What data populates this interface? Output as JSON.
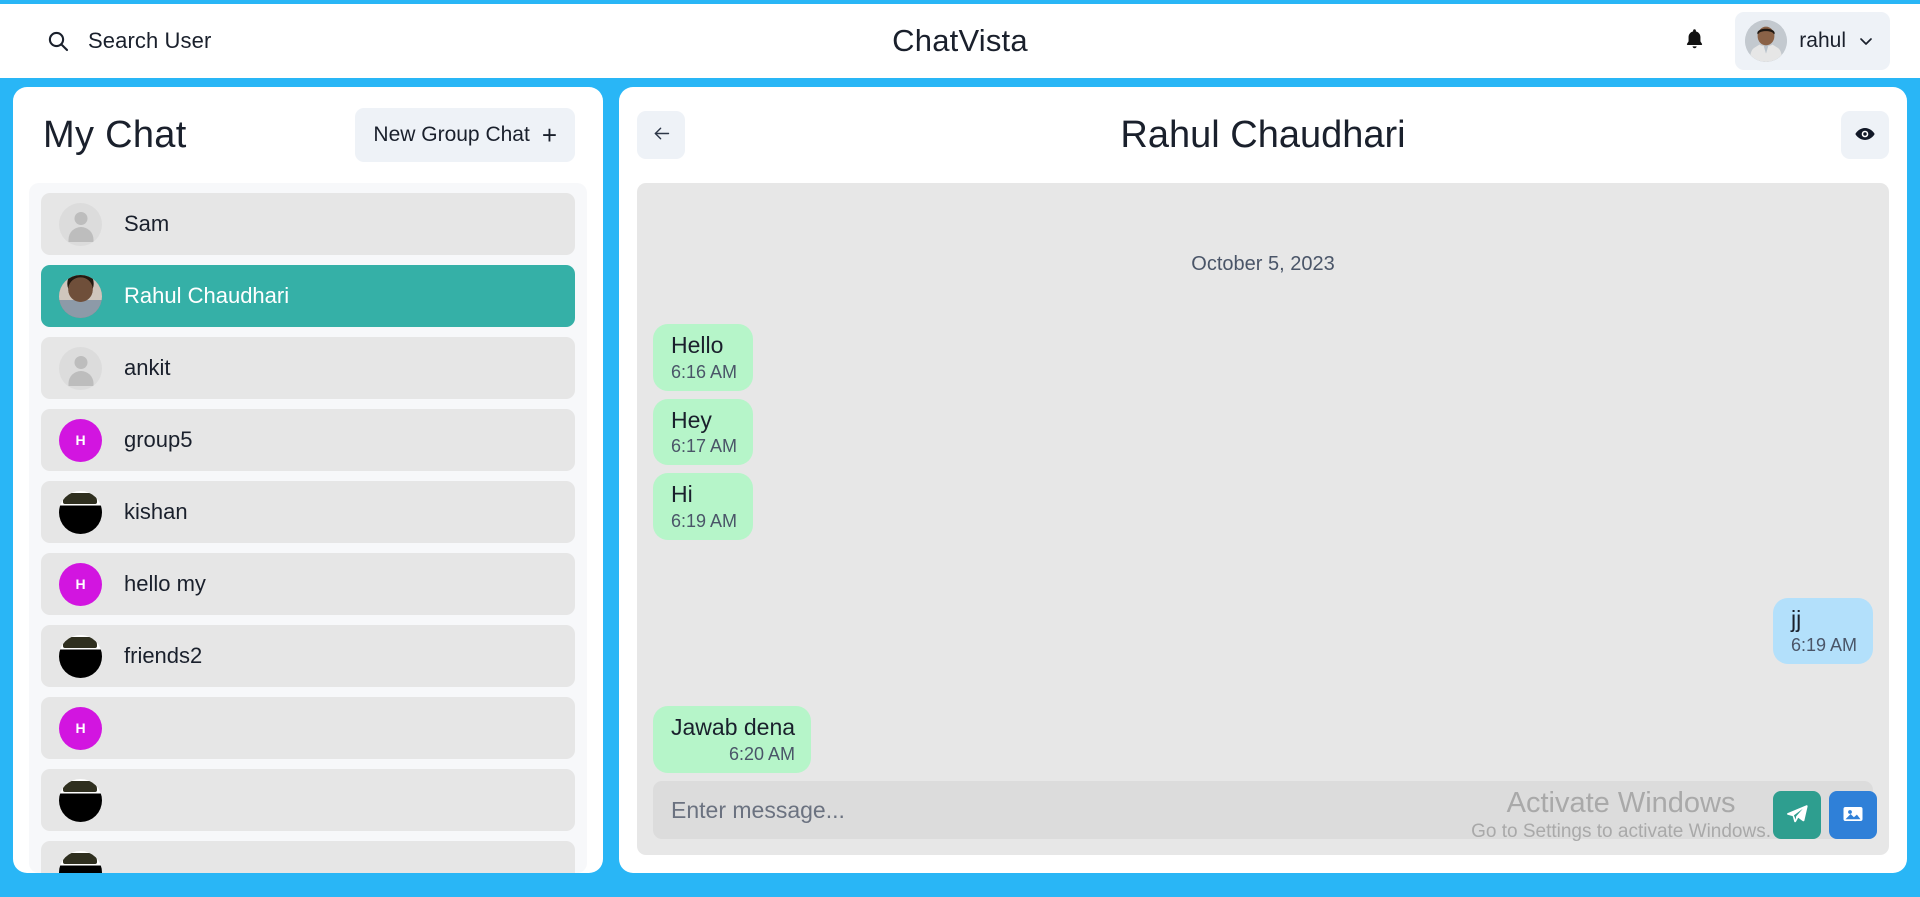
{
  "header": {
    "search": {
      "icon": "search-icon",
      "label": "Search User"
    },
    "app_title": "ChatVista",
    "notification_icon": "bell-icon",
    "profile": {
      "name": "rahul",
      "avatar": "user-photo-avatar",
      "chevron": "chevron-down-icon"
    }
  },
  "sidebar": {
    "title": "My Chat",
    "new_group_button": {
      "label": "New Group Chat",
      "icon": "plus-icon"
    },
    "items": [
      {
        "name": "Sam",
        "avatar_type": "blank",
        "avatar_letter": "",
        "selected": false
      },
      {
        "name": "Rahul Chaudhari",
        "avatar_type": "photo-face",
        "avatar_letter": "",
        "selected": true
      },
      {
        "name": "ankit",
        "avatar_type": "blank",
        "avatar_letter": "",
        "selected": false
      },
      {
        "name": "group5",
        "avatar_type": "letter",
        "avatar_letter": "H",
        "selected": false
      },
      {
        "name": "kishan",
        "avatar_type": "photo-dark",
        "avatar_letter": "",
        "selected": false
      },
      {
        "name": "hello my",
        "avatar_type": "letter",
        "avatar_letter": "H",
        "selected": false
      },
      {
        "name": "friends2",
        "avatar_type": "photo-dark",
        "avatar_letter": "",
        "selected": false
      },
      {
        "name": "",
        "avatar_type": "letter",
        "avatar_letter": "H",
        "selected": false
      },
      {
        "name": "",
        "avatar_type": "photo-dark",
        "avatar_letter": "",
        "selected": false
      },
      {
        "name": "",
        "avatar_type": "photo-dark",
        "avatar_letter": "",
        "selected": false
      }
    ]
  },
  "chat": {
    "back_icon": "arrow-left-icon",
    "title": "Rahul Chaudhari",
    "view_icon": "eye-icon",
    "date_separator": "October 5, 2023",
    "messages": [
      {
        "text": "Hello",
        "time": "6:16 AM",
        "side": "in",
        "time_align": "left"
      },
      {
        "text": "Hey",
        "time": "6:17 AM",
        "side": "in",
        "time_align": "left"
      },
      {
        "text": "Hi",
        "time": "6:19 AM",
        "side": "in",
        "time_align": "left"
      },
      {
        "text": "jj",
        "time": "6:19 AM",
        "side": "out",
        "time_align": "left"
      },
      {
        "text": "Jawab dena",
        "time": "6:20 AM",
        "side": "in",
        "time_align": "right"
      }
    ],
    "composer": {
      "placeholder": "Enter message...",
      "value": "",
      "send_icon": "send-paper-plane-icon",
      "image_icon": "image-icon"
    }
  },
  "watermark": {
    "line1": "Activate Windows",
    "line2": "Go to Settings to activate Windows."
  },
  "colors": {
    "brand_blue": "#29b6f6",
    "selected_teal": "#35b0a7",
    "group_magenta": "#d215e0",
    "bubble_in": "#b6f5c9",
    "bubble_out": "#b3e0fb",
    "send_teal": "#2e9e8f",
    "image_blue": "#2f80d8"
  }
}
